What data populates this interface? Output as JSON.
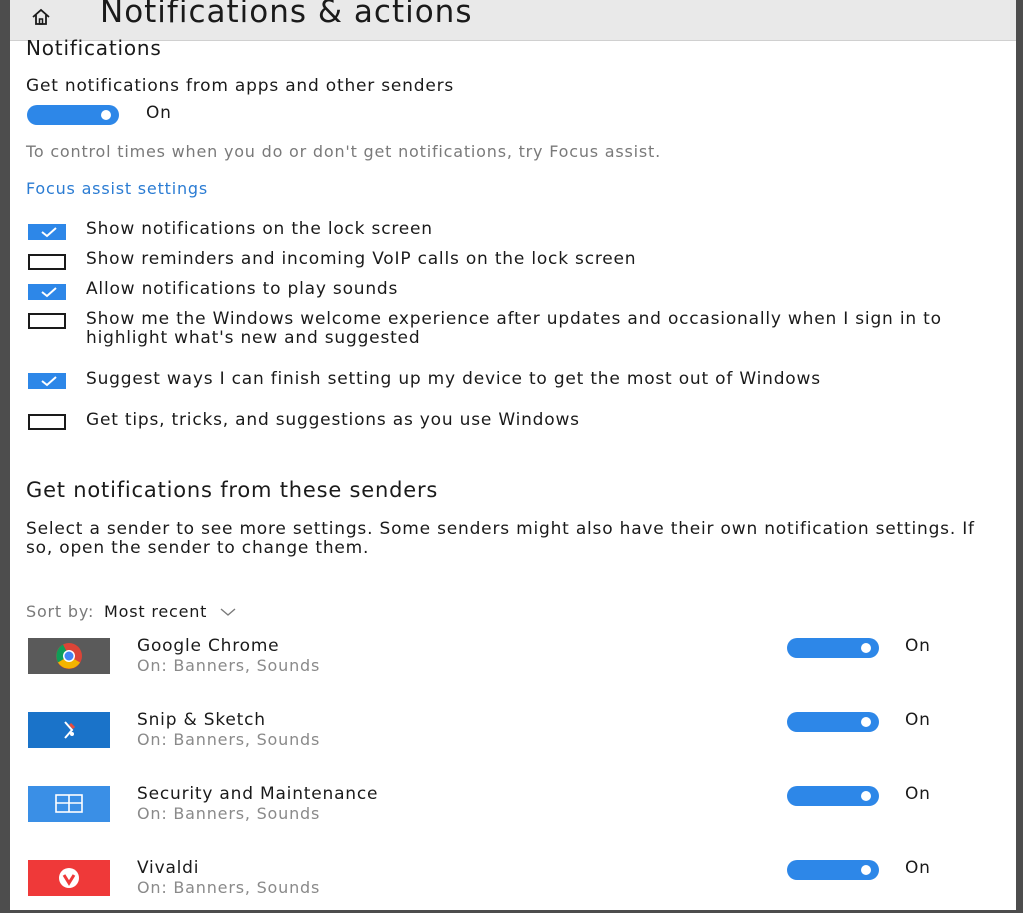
{
  "window": {
    "title": "Notifications & actions"
  },
  "notifications": {
    "heading": "Notifications",
    "get_label": "Get notifications from apps and other senders",
    "toggle_state": "On",
    "focus_hint": "To control times when you do or don't get notifications, try Focus assist.",
    "focus_link": "Focus assist settings"
  },
  "options": [
    {
      "label": "Show notifications on the lock screen",
      "checked": true
    },
    {
      "label": "Show reminders and incoming VoIP calls on the lock screen",
      "checked": false
    },
    {
      "label": "Allow notifications to play sounds",
      "checked": true
    },
    {
      "label": "Show me the Windows welcome experience after updates and occasionally when I sign in to highlight what's new and suggested",
      "checked": false
    },
    {
      "label": "Suggest ways I can finish setting up my device to get the most out of Windows",
      "checked": true
    },
    {
      "label": "Get tips, tricks, and suggestions as you use Windows",
      "checked": false
    }
  ],
  "senders_section": {
    "heading": "Get notifications from these senders",
    "description": "Select a sender to see more settings. Some senders might also have their own notification settings. If so, open the sender to change them.",
    "sort_label": "Sort by:",
    "sort_value": "Most recent"
  },
  "senders": [
    {
      "name": "Google Chrome",
      "detail": "On: Banners, Sounds",
      "state": "On",
      "icon": "chrome-icon",
      "color": "#5a5a5a"
    },
    {
      "name": "Snip & Sketch",
      "detail": "On: Banners, Sounds",
      "state": "On",
      "icon": "snip-sketch-icon",
      "color": "#1a73c9"
    },
    {
      "name": "Security and Maintenance",
      "detail": "On: Banners, Sounds",
      "state": "On",
      "icon": "security-maintenance-icon",
      "color": "#3a8fe6"
    },
    {
      "name": "Vivaldi",
      "detail": "On: Banners, Sounds",
      "state": "On",
      "icon": "vivaldi-icon",
      "color": "#ef3939"
    }
  ],
  "colors": {
    "accent": "#2d87e8",
    "link": "#2b7cd3"
  }
}
